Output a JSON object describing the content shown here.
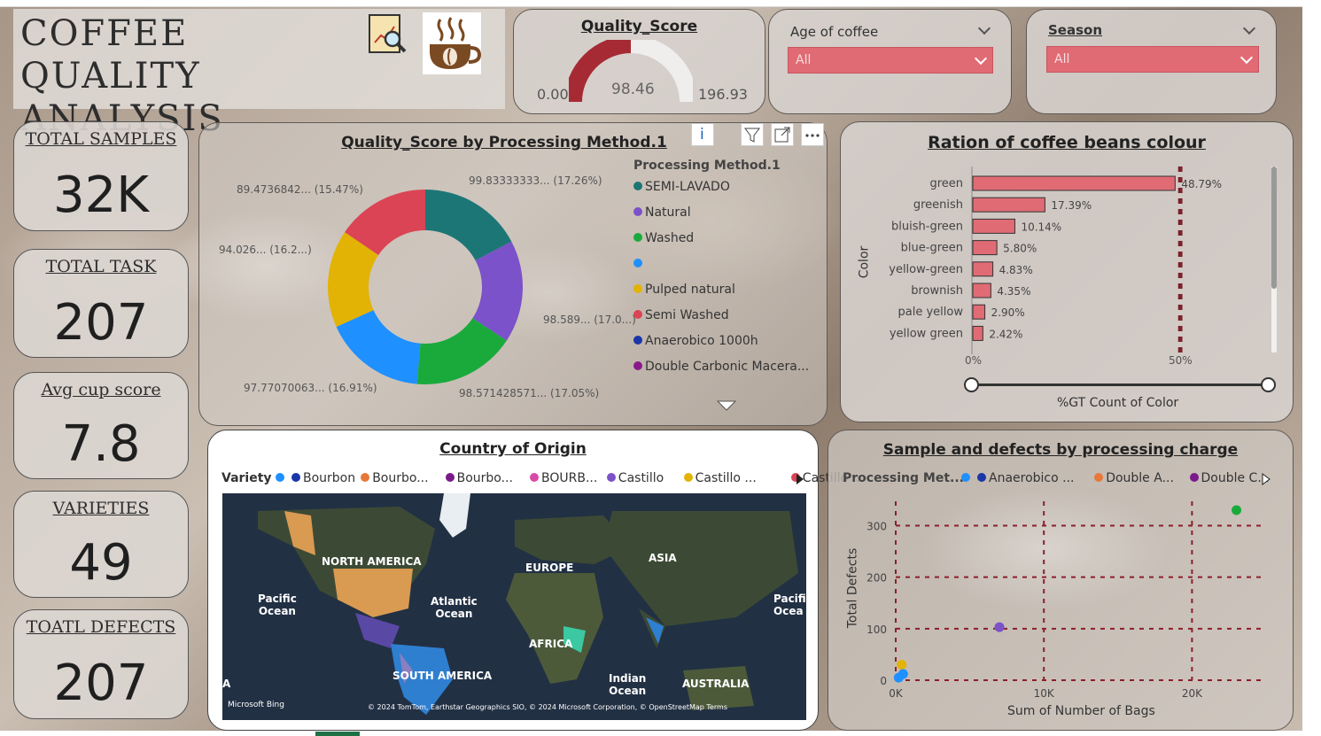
{
  "title": "COFFEE  QUALITY ANALYSIS",
  "kpis": [
    {
      "label": "TOTAL SAMPLES",
      "value": "32K"
    },
    {
      "label": "TOTAL TASK",
      "value": "207"
    },
    {
      "label": "Avg cup score",
      "value": "7.8"
    },
    {
      "label": "VARIETIES",
      "value": "49"
    },
    {
      "label": "TOATL DEFECTS",
      "value": "207"
    }
  ],
  "gauge": {
    "title": "Quality_Score",
    "min": "0.00",
    "value": "98.46",
    "max": "196.93",
    "fraction": 0.5,
    "color": "#a52a34"
  },
  "slicers": {
    "age": {
      "label": "Age of coffee",
      "value": "All"
    },
    "season": {
      "label": "Season",
      "value": "All"
    }
  },
  "donut": {
    "title": "Quality_Score by Processing Method.1",
    "legend_title": "Processing Method.1",
    "legend": [
      {
        "name": "SEMI-LAVADO",
        "color": "#1d7676"
      },
      {
        "name": "Natural",
        "color": "#7b52c9"
      },
      {
        "name": "Washed",
        "color": "#1aaa3c"
      },
      {
        "name": "",
        "color": "#1e90ff"
      },
      {
        "name": "Pulped natural",
        "color": "#e2b305"
      },
      {
        "name": "Semi Washed",
        "color": "#db4454"
      },
      {
        "name": "Anaerobico 1000h",
        "color": "#1a36a8"
      },
      {
        "name": "Double Carbonic Macera...",
        "color": "#8a1a8a"
      }
    ],
    "labels": {
      "a": "99.83333333... (17.26%)",
      "b": "98.589... (17.0...)",
      "c": "98.571428571... (17.05%)",
      "d": "97.77070063... (16.91%)",
      "e": "94.026... (16.2...)",
      "f": "89.4736842... (15.47%)"
    },
    "toolbar": {
      "info": "i"
    }
  },
  "bar": {
    "title": "Ration of coffee beans colour",
    "ylabel": "Color",
    "xlabel": "%GT Count of Color",
    "tick0": "0%",
    "tick50": "50%",
    "categories": [
      "green",
      "greenish",
      "bluish-green",
      "blue-green",
      "yellow-green",
      "brownish",
      "pale yellow",
      "yellow green"
    ],
    "values": [
      48.79,
      17.39,
      10.14,
      5.8,
      4.83,
      4.35,
      2.9,
      2.42
    ],
    "value_labels": [
      "48.79%",
      "17.39%",
      "10.14%",
      "5.80%",
      "4.83%",
      "4.35%",
      "2.90%",
      "2.42%"
    ],
    "color": "#e06b74"
  },
  "map": {
    "title": "Country of Origin",
    "legend_title": "Variety",
    "legend": [
      {
        "name": "",
        "color": "#1e90ff"
      },
      {
        "name": "Bourbon",
        "color": "#1a36a8"
      },
      {
        "name": "Bourbo...",
        "color": "#e8773a"
      },
      {
        "name": "Bourbo...",
        "color": "#7a1a8a"
      },
      {
        "name": "BOURB...",
        "color": "#d94aa6"
      },
      {
        "name": "Castillo",
        "color": "#7b52c9"
      },
      {
        "name": "Castillo ...",
        "color": "#e2b305"
      },
      {
        "name": "Castillo ...",
        "color": "#db4454"
      }
    ],
    "regions": {
      "na": "NORTH AMERICA",
      "eu": "EUROPE",
      "as": "ASIA",
      "af": "AFRICA",
      "sa": "SOUTH AMERICA",
      "au": "AUSTRALIA",
      "po": "Pacific\nOcean",
      "ao": "Atlantic\nOcean",
      "io": "Indian\nOcean",
      "po2": "Pacifi\nOcea",
      "a": "A"
    },
    "credit_left": "Microsoft Bing",
    "credit_right": "© 2024 TomTom, Earthstar Geographics SIO, © 2024 Microsoft Corporation, © OpenStreetMap  Terms"
  },
  "scatter": {
    "title": "Sample and defects by processing charge",
    "legend_title": "Processing Met...",
    "legend": [
      {
        "name": "",
        "color": "#1e90ff"
      },
      {
        "name": "Anaerobico ...",
        "color": "#1a36a8"
      },
      {
        "name": "Double A...",
        "color": "#e8773a"
      },
      {
        "name": "Double C...",
        "color": "#7a1a8a"
      }
    ],
    "ylabel": "Total Defects",
    "xlabel": "Sum of Number of Bags",
    "xticks": [
      "0K",
      "10K",
      "20K"
    ],
    "yticks": [
      "0",
      "100",
      "200",
      "300"
    ],
    "xlim": [
      0,
      25000
    ],
    "ylim": [
      0,
      330
    ],
    "points": [
      {
        "x": 23000,
        "y": 330,
        "color": "#1aaa3c"
      },
      {
        "x": 7000,
        "y": 103,
        "color": "#7b52c9"
      },
      {
        "x": 400,
        "y": 30,
        "color": "#e2b305"
      },
      {
        "x": 500,
        "y": 12,
        "color": "#1e90ff"
      },
      {
        "x": 200,
        "y": 5,
        "color": "#1e90ff"
      }
    ]
  }
}
